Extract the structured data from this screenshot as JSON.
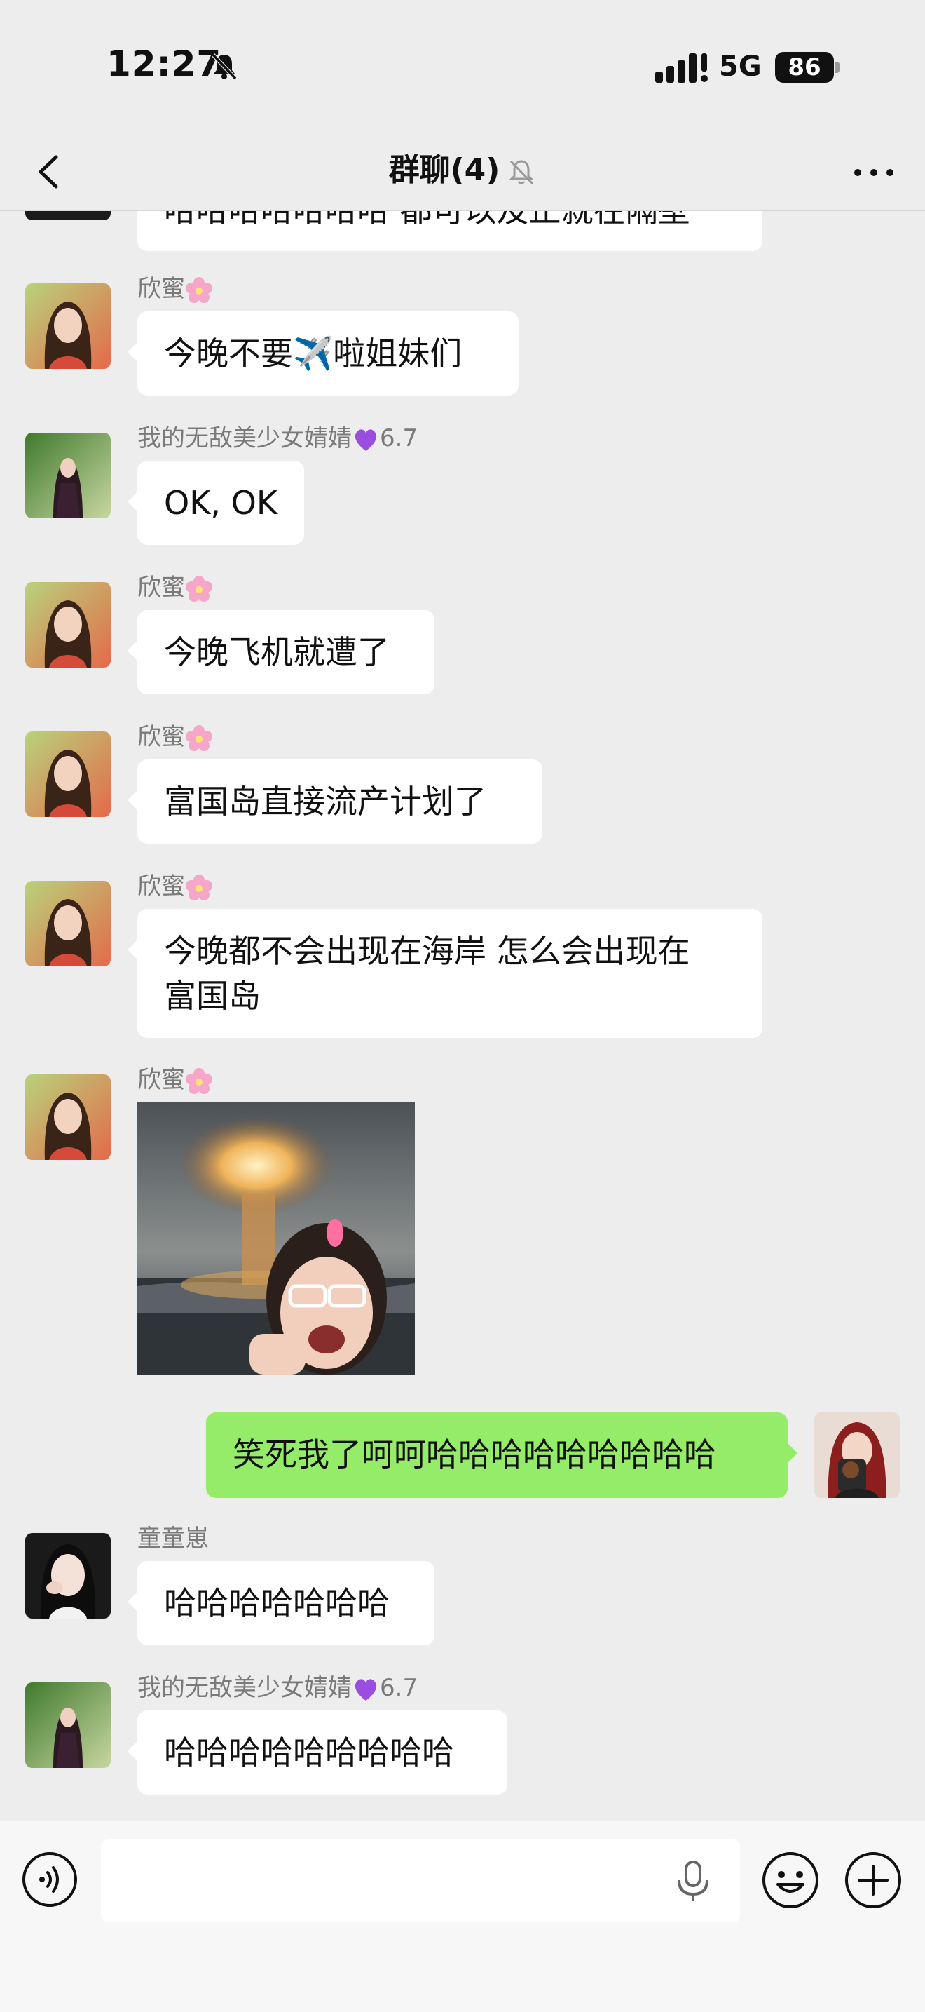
{
  "status_bar": {
    "time": "12:27",
    "network": "5G",
    "battery": "86"
  },
  "nav": {
    "title": "群聊(4)"
  },
  "messages": [
    {
      "sender": "",
      "text": "哈哈哈哈哈哈哈 都可以及止就在隔壁"
    },
    {
      "sender": "欣蜜",
      "text": "今晚不要✈️啦姐妹们"
    },
    {
      "sender": "我的无敌美少女婧婧",
      "sender_suffix": "6.7",
      "text": "OK, OK"
    },
    {
      "sender": "欣蜜",
      "text": "今晚飞机就遭了"
    },
    {
      "sender": "欣蜜",
      "text": "富国岛直接流产计划了"
    },
    {
      "sender": "欣蜜",
      "text_line1": "今晚都不会出现在海岸 怎么会出现在",
      "text_line2": "富国岛"
    },
    {
      "sender": "欣蜜",
      "image": "nuclear-explosion-meme"
    },
    {
      "sender": "me",
      "text": "笑死我了呵呵哈哈哈哈哈哈哈哈哈"
    },
    {
      "sender": "童童崽",
      "text": "哈哈哈哈哈哈哈"
    },
    {
      "sender": "我的无敌美少女婧婧",
      "sender_suffix": "6.7",
      "text": "哈哈哈哈哈哈哈哈哈"
    }
  ],
  "input": {
    "placeholder": ""
  },
  "colors": {
    "background": "#ededed",
    "my_bubble": "#95ec69",
    "other_bubble": "#ffffff",
    "sender_name": "#7a7a7a"
  }
}
